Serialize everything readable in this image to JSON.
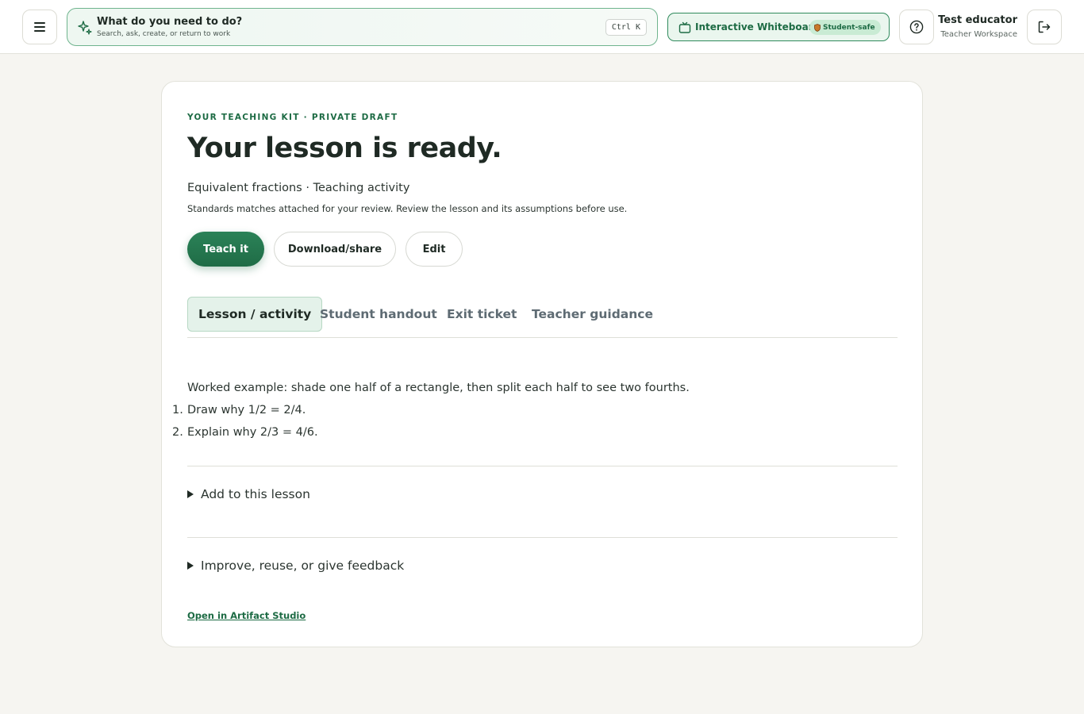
{
  "header": {
    "menu_icon": "hamburger-menu-icon",
    "command": {
      "icon": "sparkle-icon",
      "title": "What do you need to do?",
      "subtitle": "Search, ask, create, or return to work",
      "shortcut": "Ctrl K"
    },
    "whiteboard": {
      "icon": "tv-icon",
      "label": "Interactive Whiteboard",
      "badge_icon": "shield-icon",
      "badge": "Student-safe"
    },
    "help_icon": "help-circle-icon",
    "user": {
      "name": "Test educator",
      "role": "Teacher Workspace"
    },
    "logout_icon": "logout-icon"
  },
  "lesson": {
    "eyebrow": "YOUR TEACHING KIT · PRIVATE DRAFT",
    "title": "Your lesson is ready.",
    "subtitle": "Equivalent fractions · Teaching activity",
    "note": "Standards matches attached for your review. Review the lesson and its assumptions before use.",
    "actions": {
      "teach": "Teach it",
      "download": "Download/share",
      "edit": "Edit"
    },
    "tabs": [
      {
        "label": "Lesson / activity",
        "active": true
      },
      {
        "label": "Student handout",
        "active": false
      },
      {
        "label": "Exit ticket",
        "active": false
      },
      {
        "label": "Teacher guidance",
        "active": false
      }
    ],
    "content": {
      "intro": "Worked example: shade one half of a rectangle, then split each half to see two fourths.",
      "steps": [
        {
          "num": "1.",
          "text": "Draw why 1/2 = 2/4."
        },
        {
          "num": "2.",
          "text": "Explain why 2/3 = 4/6."
        }
      ]
    },
    "sections": {
      "add": "Add to this lesson",
      "improve": "Improve, reuse, or give feedback"
    },
    "studio_link": "Open in Artifact Studio"
  },
  "colors": {
    "accent": "#1d6b44",
    "primary_button": "#23774e",
    "page_bg": "#f6f5f1"
  }
}
